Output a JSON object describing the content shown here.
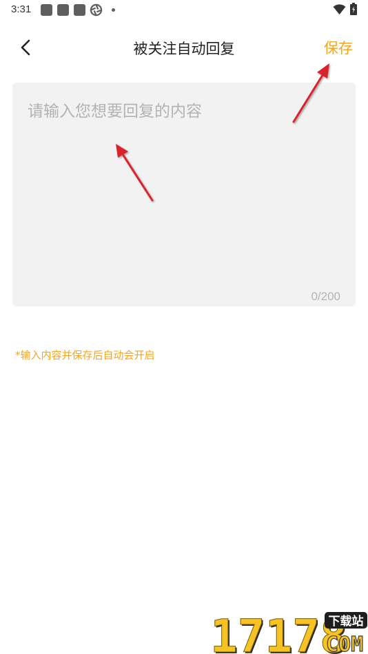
{
  "status_bar": {
    "time": "3:31"
  },
  "header": {
    "title": "被关注自动回复",
    "save_label": "保存"
  },
  "reply": {
    "placeholder": "请输入您想要回复的内容",
    "value": "",
    "counter": "0/200"
  },
  "hint": "*输入内容并保存后自动会开启",
  "watermark": {
    "digits": "17178",
    "badge": "下载站",
    "suffix": "COM"
  },
  "colors": {
    "accent": "#f5a41d",
    "annotation": "#d9232a",
    "input_bg": "#f2f2f2",
    "placeholder": "#b3b3b3"
  },
  "icons": [
    "back-arrow-icon",
    "wifi-icon",
    "battery-icon",
    "aperture-icon"
  ]
}
